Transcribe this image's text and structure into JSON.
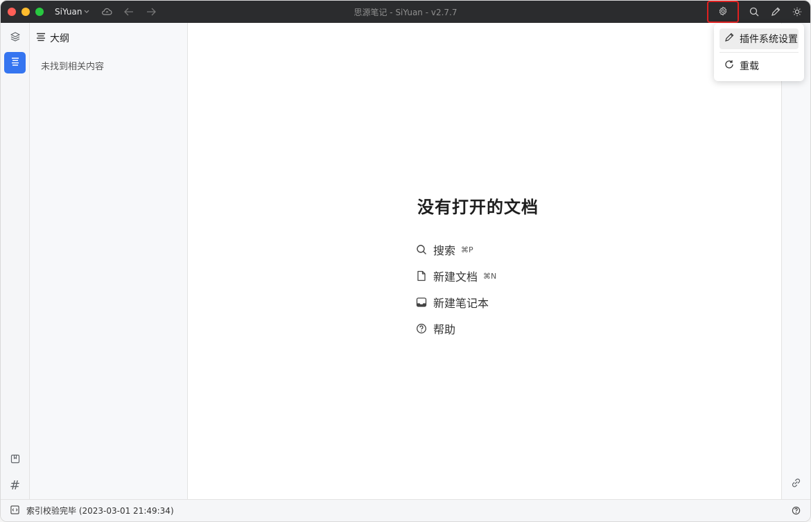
{
  "titlebar": {
    "workspace": "SiYuan",
    "title": "思源笔记 - SiYuan - v2.7.7"
  },
  "outline": {
    "title": "大纲",
    "empty_text": "未找到相关内容"
  },
  "main": {
    "empty_title": "没有打开的文档",
    "actions": [
      {
        "label": "搜索",
        "shortcut": "⌘P",
        "icon": "search-icon"
      },
      {
        "label": "新建文档",
        "shortcut": "⌘N",
        "icon": "file-icon"
      },
      {
        "label": "新建笔记本",
        "shortcut": "",
        "icon": "inbox-icon"
      },
      {
        "label": "帮助",
        "shortcut": "",
        "icon": "help-icon"
      }
    ]
  },
  "menu": {
    "items": [
      {
        "label": "插件系统设置",
        "icon": "pencil-icon"
      },
      {
        "label": "重载",
        "icon": "refresh-icon"
      }
    ]
  },
  "status": {
    "text": "索引校验完毕 (2023-03-01 21:49:34)"
  },
  "colors": {
    "accent": "#3575f0",
    "highlight_border": "#e02020",
    "titlebar": "#2b2c2e"
  }
}
